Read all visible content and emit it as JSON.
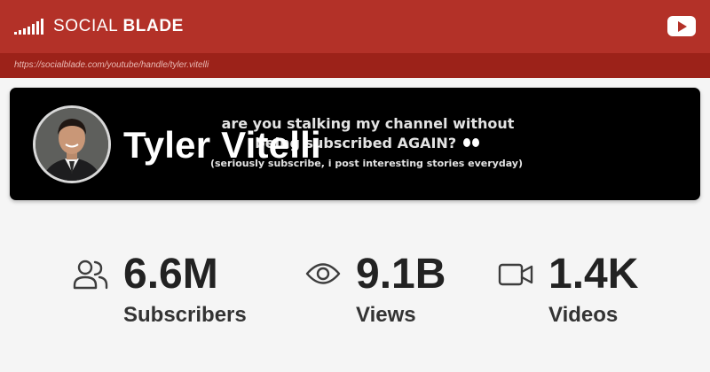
{
  "header": {
    "logo_text_regular": "SOCIAL",
    "logo_text_bold": "BLADE",
    "youtube_icon": "youtube-icon"
  },
  "url_bar": {
    "url": "https://socialblade.com/youtube/handle/tyler.vitelli"
  },
  "channel": {
    "name": "Tyler Vitelli",
    "banner_line_1": "are you stalking my channel without",
    "banner_line_2": "being subscribed AGAIN?",
    "banner_line_3": "(seriously subscribe, i post interesting stories everyday)"
  },
  "stats": [
    {
      "icon": "users-icon",
      "value": "6.6M",
      "label": "Subscribers"
    },
    {
      "icon": "eye-icon",
      "value": "9.1B",
      "label": "Views"
    },
    {
      "icon": "video-camera-icon",
      "value": "1.4K",
      "label": "Videos"
    }
  ],
  "colors": {
    "header": "#b33128",
    "url_bar": "#9c2219",
    "banner": "#000000",
    "page": "#f5f5f5"
  }
}
